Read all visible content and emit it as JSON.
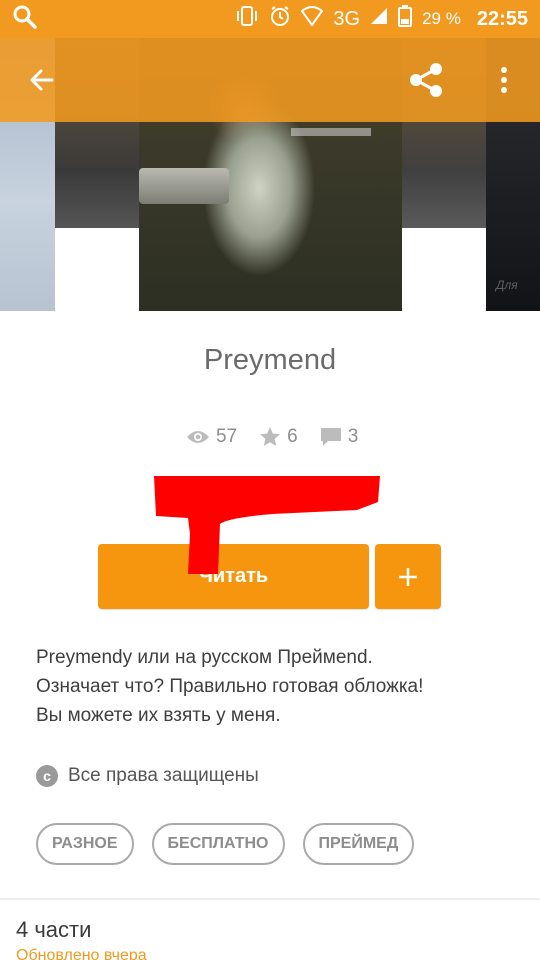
{
  "status_bar": {
    "network": "3G",
    "battery_percent": "29 %",
    "time": "22:55",
    "icons": [
      "search-icon",
      "vibrate-icon",
      "alarm-icon",
      "signal-icon",
      "battery-icon"
    ]
  },
  "toolbar": {
    "icons": [
      "back-arrow-icon",
      "share-icon",
      "more-vertical-icon"
    ]
  },
  "cover": {
    "right_edge_text": "Для"
  },
  "story": {
    "title": "Preymend",
    "stats": {
      "views": "57",
      "votes": "6",
      "comments": "3"
    },
    "read_button_label": "Читать",
    "add_button_label": "+",
    "description_lines": [
      "Preymendy или на русском Преймend.",
      "Означает что? Правильно готовая обложка!",
      "Вы можете их взять у меня."
    ],
    "copyright_label": "Все права защищены",
    "tags": [
      "РАЗНОЕ",
      "БЕСПЛАТНО",
      "ПРЕЙМЕД"
    ]
  },
  "parts": {
    "title": "4 части",
    "updated": "Обновлено вчера"
  },
  "colors": {
    "accent": "#f29a1f",
    "button": "#f6960f",
    "redaction": "#ff0000"
  }
}
